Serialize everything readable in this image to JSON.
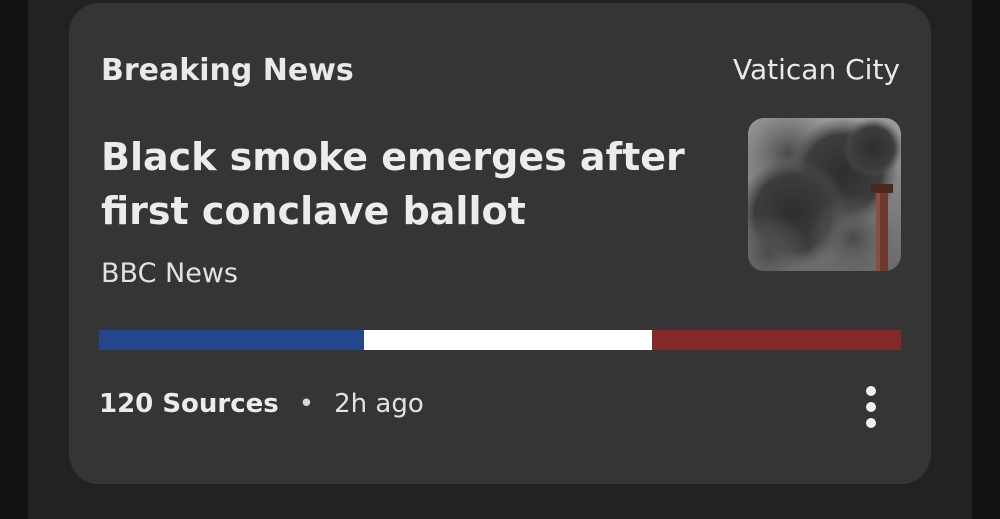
{
  "card": {
    "category": "Breaking News",
    "location": "Vatican City",
    "headline": "Black smoke emerges after first conclave ballot",
    "publisher": "BBC News",
    "thumbnail_icon": "smoke-photo",
    "bias_distribution": [
      {
        "name": "left",
        "fraction": 0.33,
        "color": "#23478a"
      },
      {
        "name": "center",
        "fraction": 0.36,
        "color": "#ffffff"
      },
      {
        "name": "right",
        "fraction": 0.31,
        "color": "#852a2a"
      }
    ],
    "sources_count": "120 Sources",
    "separator": "•",
    "time_ago": "2h ago",
    "menu_icon": "more-vertical-icon"
  }
}
